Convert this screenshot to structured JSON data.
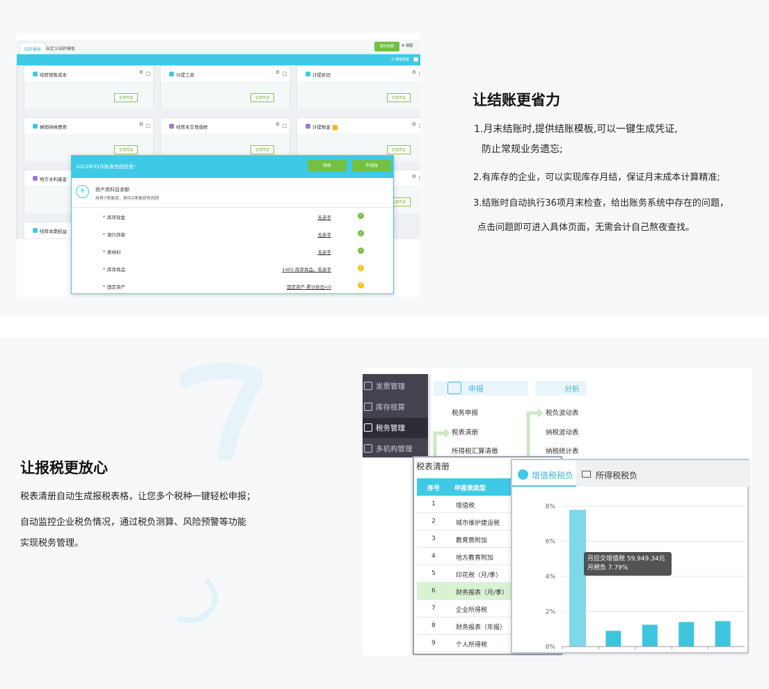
{
  "section1": {
    "heading": "让结账更省力",
    "lines": [
      "1.月末结账时,提供结账模板,可以一键生成凭证,",
      "防止常规业务遗忘;",
      "2.有库存的企业，可以实现库存月结，保证月末成本计算精准;",
      "3.结账时自动执行36项月末检查，给出账务系统中存在的问题，",
      "点击问题即可进入具体页面，无需会计自己熬夜查找。"
    ]
  },
  "screen1": {
    "tabs": [
      "结转模板",
      "自定义结转模板"
    ],
    "primary_button": "期末余额",
    "view_label": "视图",
    "bar_label": "模板配置",
    "generate_label": "生成凭证",
    "cards": [
      {
        "title": "结转销售成本",
        "color": "#3ecae6"
      },
      {
        "title": "计提工资",
        "color": "#3ecae6"
      },
      {
        "title": "计提折旧",
        "color": "#3ecae6"
      },
      {
        "title": "摊销待摊费用",
        "color": "#3ecae6"
      },
      {
        "title": "结转未交增值税",
        "color": "#9b7bd6"
      },
      {
        "title": "计提税金",
        "color": "#9b7bd6"
      },
      {
        "title": "地方水利基金",
        "color": "#9b7bd6"
      },
      {
        "title": "结转本期损益",
        "color": "#3ecae6"
      }
    ],
    "modal": {
      "title": "2023年03月账表完成检查!",
      "btn_settle": "结账",
      "btn_skip": "不结账",
      "section_icon": "yuan-icon",
      "section_title": "资产类科目余额",
      "section_sub": "共有7项类目，其中2项类目有风险",
      "rows": [
        {
          "name": "库存现金",
          "value": "无赤字",
          "status": "ok"
        },
        {
          "name": "银行存款",
          "value": "无赤字",
          "status": "ok"
        },
        {
          "name": "原材料",
          "value": "无赤字",
          "status": "ok"
        },
        {
          "name": "库存商品",
          "value": "1405 库存商品，有赤字",
          "status": "warn"
        },
        {
          "name": "固定资产",
          "value": "固定资产-累计折旧<0",
          "status": "warn"
        }
      ]
    }
  },
  "section2": {
    "heading": "让报税更放心",
    "lines": [
      "税表清册自动生成报税表格，让您多个税种一键轻松申报；",
      "自动监控企业税负情况，通过税负测算、风险预警等功能",
      "实现税务管理。"
    ]
  },
  "screen2": {
    "sidebar": [
      {
        "label": "发票管理",
        "icon": "invoice-icon"
      },
      {
        "label": "库存核算",
        "icon": "inventory-icon"
      },
      {
        "label": "税务管理",
        "icon": "tax-icon",
        "active": true
      },
      {
        "label": "多机构管理",
        "icon": "org-icon"
      }
    ],
    "menu": {
      "declare": "申报",
      "analysis": "分析",
      "left_items": [
        "税务申报",
        "税表清册",
        "所得税汇算清缴"
      ],
      "right_items": [
        "税负波动表",
        "纳税波动表",
        "纳税统计表"
      ]
    },
    "table_panel": {
      "title": "税表清册",
      "headers": [
        "序号",
        "申报表类型"
      ],
      "rows": [
        {
          "no": "1",
          "type": "增值税"
        },
        {
          "no": "2",
          "type": "城市维护建设税"
        },
        {
          "no": "3",
          "type": "教育费附加"
        },
        {
          "no": "4",
          "type": "地方教育附加"
        },
        {
          "no": "5",
          "type": "印花税（月/季）"
        },
        {
          "no": "6",
          "type": "财务报表（月/季）",
          "highlight": true
        },
        {
          "no": "7",
          "type": "企业所得税"
        },
        {
          "no": "8",
          "type": "财务报表（年报）"
        },
        {
          "no": "9",
          "type": "个人所得税"
        }
      ]
    },
    "chart_panel": {
      "tab_active": "增值税税负",
      "tab_other": "所得税税负",
      "tooltip_line1": "月应交增值税 59,949.34元",
      "tooltip_line2": "月税负 7.79%"
    }
  },
  "chart_data": {
    "type": "bar",
    "title": "",
    "xlabel": "",
    "ylabel": "",
    "ylim": [
      0,
      8
    ],
    "yticks": [
      "0%",
      "2%",
      "4%",
      "6%",
      "8%"
    ],
    "values": [
      7.79,
      0.9,
      1.25,
      1.4,
      1.45
    ],
    "color": "#7fd7ea",
    "grid": true
  }
}
